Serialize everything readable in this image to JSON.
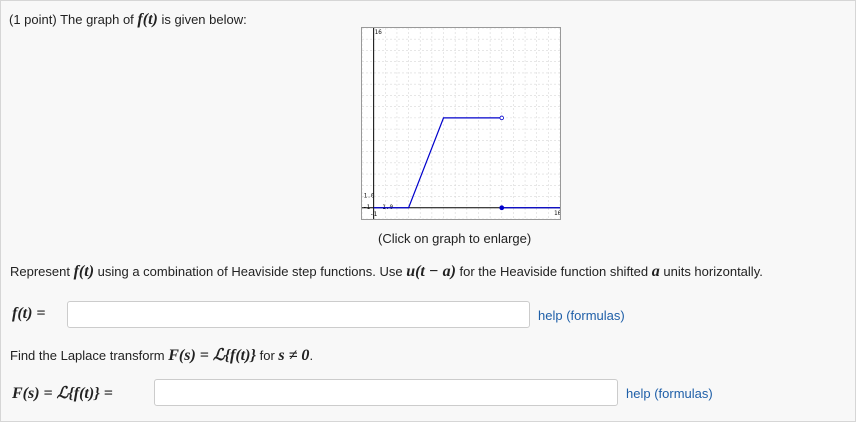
{
  "problem": {
    "intro_prefix": "(1 point) The graph of ",
    "intro_func": "f(t)",
    "intro_suffix": " is given below:",
    "graph_caption": "(Click on graph to enlarge)",
    "represent_prefix": "Represent ",
    "represent_func": "f(t)",
    "represent_mid": " using a combination of Heaviside step functions. Use ",
    "represent_u": "u(t − a)",
    "represent_mid2": " for the Heaviside function shifted ",
    "represent_a": "a",
    "represent_suffix": " units horizontally.",
    "f_label": "f(t) =",
    "laplace_prefix": "Find the Laplace transform ",
    "laplace_expr": "F(s) = ℒ{f(t)}",
    "laplace_mid": " for ",
    "laplace_cond": "s ≠ 0",
    "laplace_suffix": ".",
    "F_label": "F(s) = ℒ{f(t)} =",
    "answer1_value": "",
    "answer2_value": "",
    "help_label": "help (formulas)"
  },
  "graph": {
    "tick_labels": {
      "y_top": "16",
      "y_one": "1.0",
      "x_one": "1.0",
      "x_right": "16",
      "x_left": "-1",
      "y_bottom": "-1"
    },
    "line_color": "#0000cc",
    "series": [
      {
        "x": [
          0,
          3,
          6,
          11
        ],
        "y": [
          0,
          0,
          8,
          8
        ],
        "end": "open"
      },
      {
        "x": [
          11,
          16
        ],
        "y": [
          0,
          0
        ],
        "start": "closed"
      }
    ]
  }
}
